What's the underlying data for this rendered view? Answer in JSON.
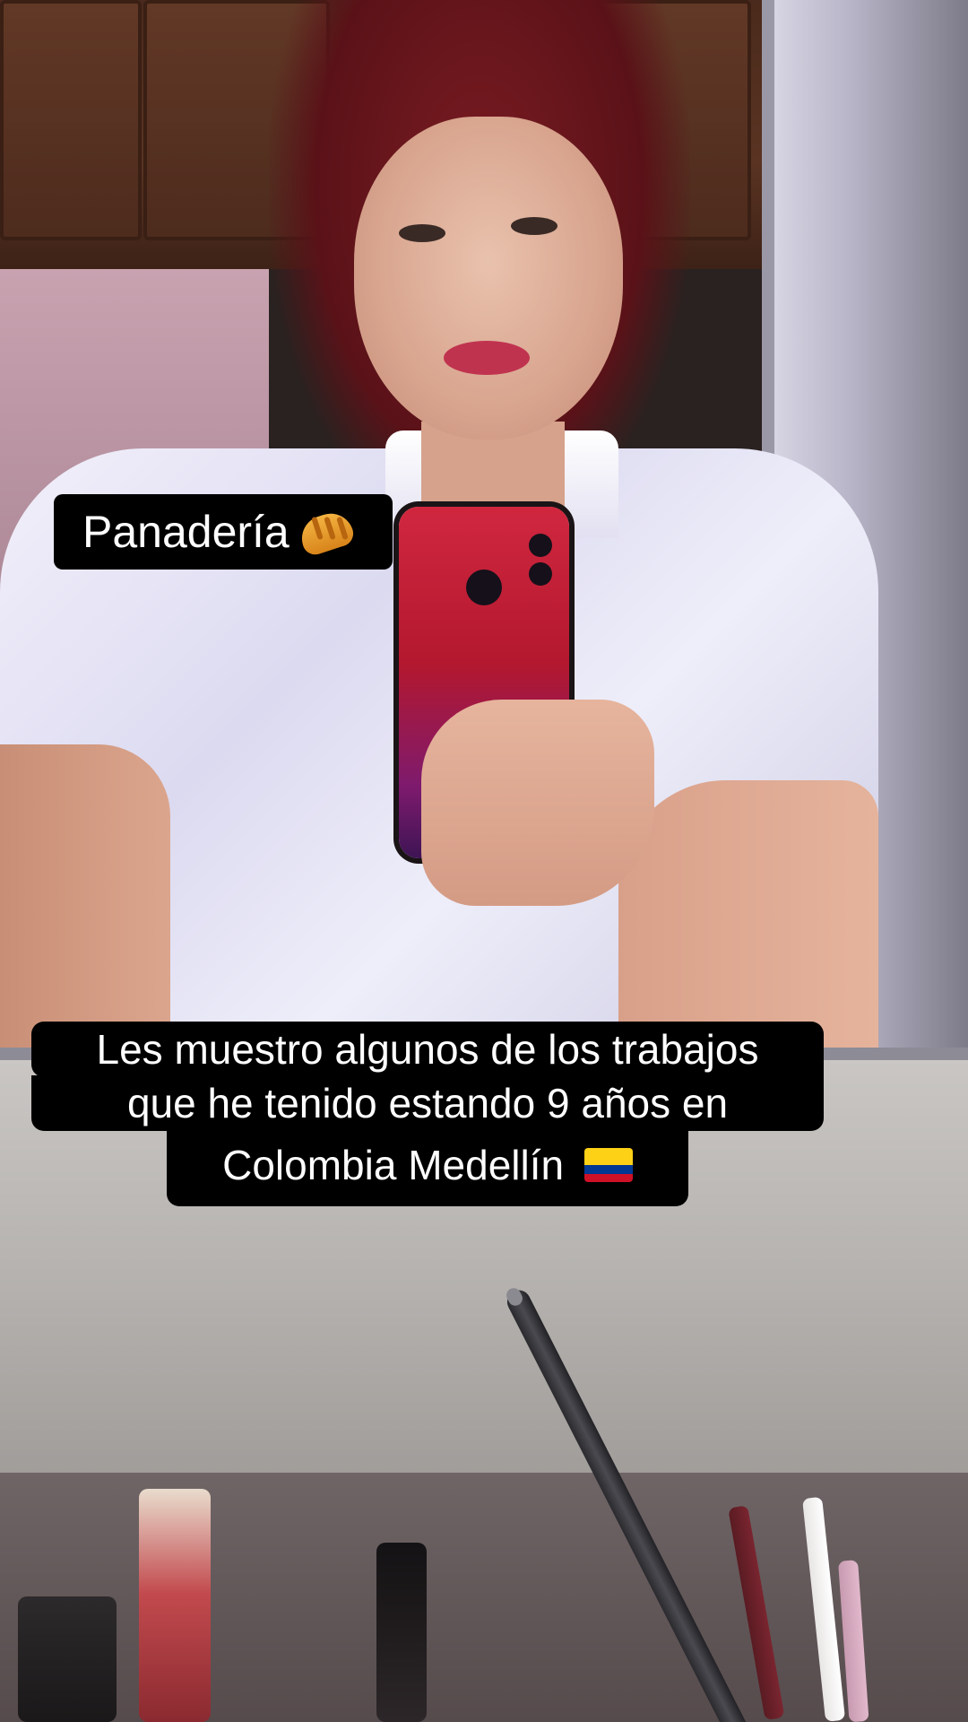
{
  "overlays": {
    "tag_label": "Panadería",
    "tag_emoji": "croissant-icon",
    "caption_line_1": "Les muestro algunos de los trabajos",
    "caption_line_2": "que he tenido estando 9 años en",
    "caption_line_3": "Colombia Medellín",
    "caption_emoji": "colombia-flag-icon"
  },
  "colors": {
    "caption_bg": "#000000",
    "caption_text": "#ffffff",
    "flag_yellow": "#fcd116",
    "flag_blue": "#003893",
    "flag_red": "#ce1126"
  }
}
